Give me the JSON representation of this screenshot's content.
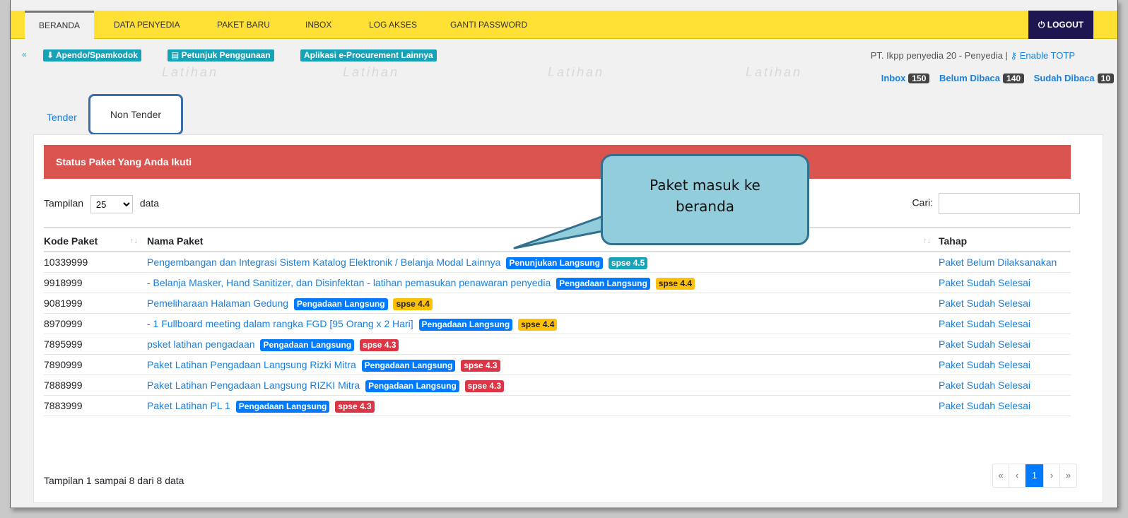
{
  "nav": {
    "items": [
      "BERANDA",
      "DATA PENYEDIA",
      "PAKET BARU",
      "INBOX",
      "LOG AKSES",
      "GANTI PASSWORD"
    ],
    "logout": "LOGOUT"
  },
  "subbar": {
    "btn1": "Apendo/Spamkodok",
    "btn2": "Petunjuk Penggunaan",
    "btn3": "Aplikasi e-Procurement Lainnya"
  },
  "user": {
    "info": "PT. Ikpp penyedia 20 - Penyedia |",
    "totp": "Enable TOTP"
  },
  "inbox": {
    "inbox_label": "Inbox",
    "inbox_count": "150",
    "unread_label": "Belum Dibaca",
    "unread_count": "140",
    "read_label": "Sudah Dibaca",
    "read_count": "10"
  },
  "watermark": "Latihan",
  "tabs": {
    "tender": "Tender",
    "non_tender": "Non Tender"
  },
  "panel": {
    "title": "Status Paket Yang Anda Ikuti",
    "length_prefix": "Tampilan",
    "length_value": "25",
    "length_suffix": "data",
    "search_label": "Cari:",
    "search_value": "",
    "columns": {
      "code": "Kode Paket",
      "name": "Nama Paket",
      "stage": "Tahap"
    },
    "rows": [
      {
        "code": "10339999",
        "name": "Pengembangan dan Integrasi Sistem Katalog Elektronik / Belanja Modal Lainnya",
        "method": "Penunjukan Langsung",
        "method_color": "blue",
        "version": "spse 4.5",
        "version_color": "teal",
        "stage": "Paket Belum Dilaksanakan"
      },
      {
        "code": "9918999",
        "name": "- Belanja Masker, Hand Sanitizer, dan Disinfektan - latihan pemasukan penawaran penyedia",
        "method": "Pengadaan Langsung",
        "method_color": "blue",
        "version": "spse 4.4",
        "version_color": "yellow",
        "stage": "Paket Sudah Selesai"
      },
      {
        "code": "9081999",
        "name": "Pemeliharaan Halaman Gedung",
        "method": "Pengadaan Langsung",
        "method_color": "blue",
        "version": "spse 4.4",
        "version_color": "yellow",
        "stage": "Paket Sudah Selesai"
      },
      {
        "code": "8970999",
        "name": "- 1 Fullboard meeting dalam rangka FGD [95 Orang x 2 Hari]",
        "method": "Pengadaan Langsung",
        "method_color": "blue",
        "version": "spse 4.4",
        "version_color": "yellow",
        "stage": "Paket Sudah Selesai"
      },
      {
        "code": "7895999",
        "name": "psket latihan pengadaan",
        "method": "Pengadaan Langsung",
        "method_color": "blue",
        "version": "spse 4.3",
        "version_color": "red",
        "stage": "Paket Sudah Selesai"
      },
      {
        "code": "7890999",
        "name": "Paket Latihan Pengadaan Langsung Rizki Mitra",
        "method": "Pengadaan Langsung",
        "method_color": "blue",
        "version": "spse 4.3",
        "version_color": "red",
        "stage": "Paket Sudah Selesai"
      },
      {
        "code": "7888999",
        "name": "Paket Latihan Pengadaan Langsung RIZKI Mitra",
        "method": "Pengadaan Langsung",
        "method_color": "blue",
        "version": "spse 4.3",
        "version_color": "red",
        "stage": "Paket Sudah Selesai"
      },
      {
        "code": "7883999",
        "name": "Paket Latihan PL 1",
        "method": "Pengadaan Langsung",
        "method_color": "blue",
        "version": "spse 4.3",
        "version_color": "red",
        "stage": "Paket Sudah Selesai"
      }
    ],
    "info": "Tampilan 1 sampai 8 dari 8 data",
    "pager": {
      "first": "«",
      "prev": "‹",
      "current": "1",
      "next": "›",
      "last": "»"
    }
  },
  "callout": {
    "line1": "Paket masuk ke",
    "line2": "beranda"
  },
  "colors": {
    "nav_bg": "#ffe135",
    "logout_bg": "#1e1650",
    "panel_head": "#d9534f",
    "link": "#1a7fdc",
    "callout_fill": "#92cddc",
    "callout_border": "#31718e"
  }
}
